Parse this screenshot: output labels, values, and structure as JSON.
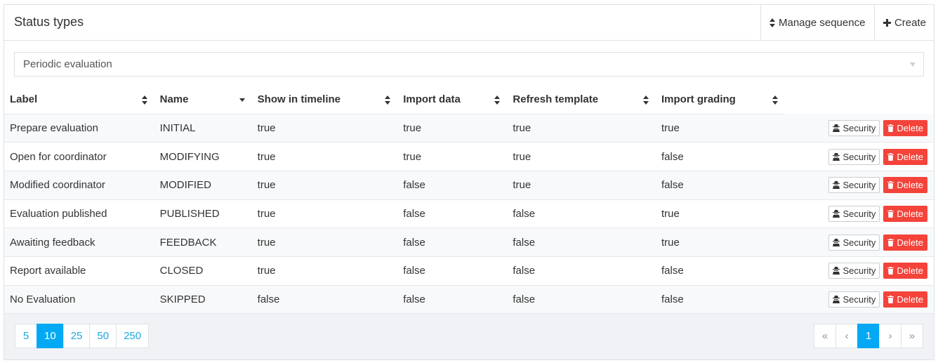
{
  "header": {
    "title": "Status types",
    "manage_label": "Manage sequence",
    "create_label": "Create"
  },
  "filter": {
    "selected": "Periodic evaluation"
  },
  "table": {
    "columns": [
      "Label",
      "Name",
      "Show in timeline",
      "Import data",
      "Refresh template",
      "Import grading"
    ],
    "rows": [
      [
        "Prepare evaluation",
        "INITIAL",
        "true",
        "true",
        "true",
        "true"
      ],
      [
        "Open for coordinator",
        "MODIFYING",
        "true",
        "true",
        "true",
        "false"
      ],
      [
        "Modified coordinator",
        "MODIFIED",
        "true",
        "false",
        "true",
        "false"
      ],
      [
        "Evaluation published",
        "PUBLISHED",
        "true",
        "false",
        "false",
        "true"
      ],
      [
        "Awaiting feedback",
        "FEEDBACK",
        "true",
        "false",
        "false",
        "true"
      ],
      [
        "Report available",
        "CLOSED",
        "true",
        "false",
        "false",
        "false"
      ],
      [
        "No Evaluation",
        "SKIPPED",
        "false",
        "false",
        "false",
        "false"
      ]
    ],
    "security_label": "Security",
    "delete_label": "Delete"
  },
  "pagination": {
    "sizes": [
      "5",
      "10",
      "25",
      "50",
      "250"
    ],
    "active_size": "10",
    "first": "«",
    "prev": "‹",
    "current": "1",
    "next": "›",
    "last": "»"
  },
  "colors": {
    "accent": "#03a9f4",
    "danger": "#f4433a"
  }
}
